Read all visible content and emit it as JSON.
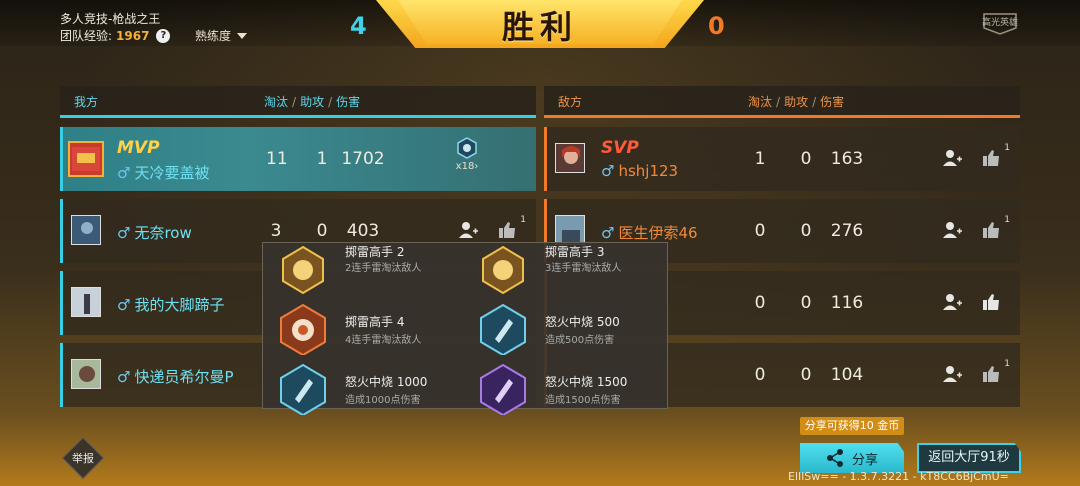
{
  "header": {
    "mode": "多人竞技-枪战之王",
    "exp_label": "团队经验:",
    "exp_value": "1967",
    "help": "?",
    "proficiency": "熟练度",
    "score_my": "4",
    "score_enemy": "0",
    "result": "胜利",
    "hero_label": "高光英雄"
  },
  "my_team": {
    "label": "我方",
    "col_kills": "淘汰",
    "col_assists": "助攻",
    "col_damage": "伤害",
    "col_sep": "/",
    "players": [
      {
        "tag": "MVP",
        "name": "天冷要盖被",
        "gender": "♂",
        "kills": "11",
        "assists": "1",
        "damage": "1702",
        "badge_count": "x18›"
      },
      {
        "name": "无奈row",
        "gender": "♂",
        "kills": "3",
        "assists": "0",
        "damage": "403",
        "likes": "1"
      },
      {
        "name": "我的大脚蹄子",
        "gender": "♂"
      },
      {
        "name": "快递员希尔曼P",
        "gender": "♂"
      }
    ]
  },
  "enemy_team": {
    "label": "敌方",
    "col_kills": "淘汰",
    "col_assists": "助攻",
    "col_damage": "伤害",
    "col_sep": "/",
    "players": [
      {
        "tag": "SVP",
        "name": "hshj123",
        "gender": "♂",
        "kills": "1",
        "assists": "0",
        "damage": "163",
        "likes": "1"
      },
      {
        "name": "医生伊索46",
        "gender": "♂",
        "kills": "0",
        "assists": "0",
        "damage": "276",
        "likes": "1"
      },
      {
        "kills": "0",
        "assists": "0",
        "damage": "116"
      },
      {
        "kills": "0",
        "assists": "0",
        "damage": "104",
        "likes": "1"
      }
    ]
  },
  "achievements": [
    {
      "title": "掷雷高手 2",
      "desc": "2连手雷淘汰敌人",
      "icon": "grenade-gold-icon"
    },
    {
      "title": "掷雷高手 3",
      "desc": "3连手雷淘汰敌人",
      "icon": "grenade-gold-icon"
    },
    {
      "title": "掷雷高手 4",
      "desc": "4连手雷淘汰敌人",
      "icon": "grenade-orange-icon"
    },
    {
      "title": "怒火中烧 500",
      "desc": "造成500点伤害",
      "icon": "bullet-blue-icon"
    },
    {
      "title": "怒火中烧 1000",
      "desc": "造成1000点伤害",
      "icon": "bullet-blue-icon"
    },
    {
      "title": "怒火中烧 1500",
      "desc": "造成1500点伤害",
      "icon": "bullet-purple-icon"
    }
  ],
  "footer": {
    "report": "举报",
    "share_tip": "分享可获得10 金币",
    "share": "分享",
    "back_lobby": "返回大厅91秒",
    "version": "ElIlSw== - 1.3.7.3221 - kT8CC6BjCmU="
  },
  "colors": {
    "my_team": "#36cfe3",
    "enemy_team": "#f07a2a",
    "banner": "#f6b226",
    "mvp_row": "#3a8a90"
  }
}
